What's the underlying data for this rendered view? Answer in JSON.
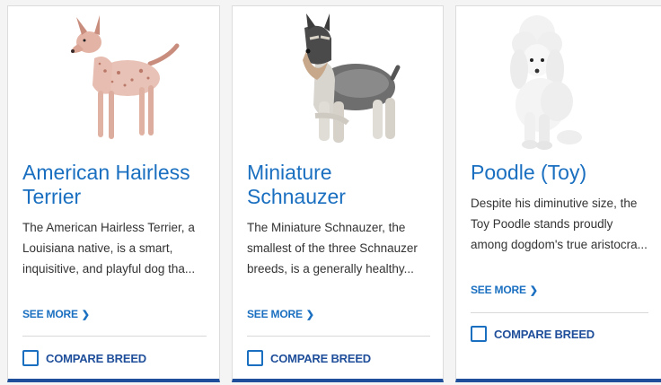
{
  "cards": [
    {
      "name": "American Hairless Terrier",
      "description": "The American Hairless Terrier, a Louisiana native, is a smart, inquisitive, and playful dog tha...",
      "see_more": "SEE MORE",
      "compare": "COMPARE BREED",
      "image": "american-hairless-terrier-photo"
    },
    {
      "name": "Miniature Schnauzer",
      "description": "The Miniature Schnauzer, the smallest of the three Schnauzer breeds, is a generally healthy...",
      "see_more": "SEE MORE",
      "compare": "COMPARE BREED",
      "image": "miniature-schnauzer-photo"
    },
    {
      "name": "Poodle (Toy)",
      "description": "Despite his diminutive size, the Toy Poodle stands proudly among dogdom's true aristocra...",
      "see_more": "SEE MORE",
      "compare": "COMPARE BREED",
      "image": "toy-poodle-photo"
    }
  ],
  "colors": {
    "link": "#1a6fc0",
    "accent": "#1f4e9a",
    "text": "#333333"
  }
}
